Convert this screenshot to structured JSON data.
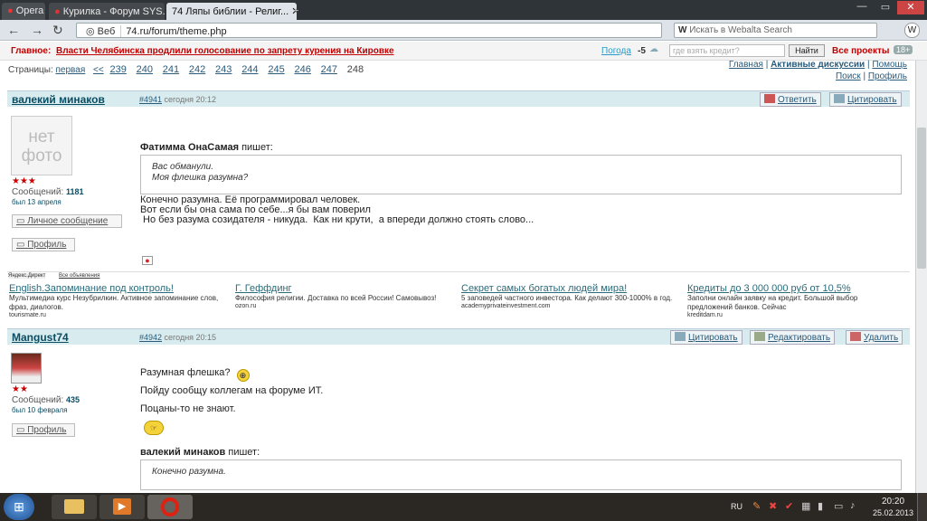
{
  "browser": {
    "opera_tab": "Opera",
    "tab1": "Курилка - Форум SYS...",
    "tab2": "74 Ляпы библии - Религ...",
    "new_tab": "+",
    "web": "Веб",
    "address": "74.ru/forum/theme.php",
    "search_placeholder": "Искать в Webalta Search",
    "back": "←",
    "fwd": "→",
    "reload": "↻"
  },
  "news": {
    "label": "Главное:",
    "headline": "Власти Челябинска продлили голосование по запрету курения на Кировке",
    "weather_label": "Погода",
    "weather_value": "-5",
    "search_placeholder": "где взять кредит?",
    "search_btn": "Найти",
    "projects": "Все проекты",
    "age": "18+"
  },
  "pager": {
    "label": "Страницы:",
    "first": "первая",
    "prev": "<<",
    "pages": [
      "239",
      "240",
      "241",
      "242",
      "243",
      "244",
      "245",
      "246",
      "247",
      "248"
    ]
  },
  "toplinks": {
    "main": "Главная",
    "active": "Активные дискуссии",
    "help": "Помощь",
    "search": "Поиск",
    "profile": "Профиль"
  },
  "post1": {
    "author": "валекий минаков",
    "num": "#4941",
    "date": "сегодня 20:12",
    "reply": "Ответить",
    "quote_btn": "Цитировать",
    "avatar_text": "нет фото",
    "stars": "★★★",
    "msgs_label": "Сообщений:",
    "msgs": "1181",
    "was": "был 13 апреля",
    "pm": "Личное сообщение",
    "profile": "Профиль",
    "quote_author": "Фатимма ОнаСамая",
    "writes": "пишет:",
    "quote_l1": "Вас обманули.",
    "quote_l2": "Моя флешка разумна?",
    "body_l1": "Конечно разумна. Её программировал человек.",
    "body_l2": "Вот если бы она сама по себе...я бы вам поверил",
    "body_l3": " Но без разума созидателя - никуда.  Как ни крути,  а впереди должно стоять слово..."
  },
  "ads": {
    "label1": "Яндекс.Директ",
    "label2": "Все объявления",
    "items": [
      {
        "title": "English.Запоминание под контроль!",
        "text": "Мультимедиа курс Незубрилкин. Активное запоминание слов, фраз, диалогов.",
        "url": "tourismate.ru"
      },
      {
        "title": "Г. Геффдинг",
        "text": "Философия религии. Доставка по всей России! Самовывоз!",
        "url": "ozon.ru"
      },
      {
        "title": "Секрет самых богатых людей мира!",
        "text": "5 заповедей частного инвестора. Как делают 300-1000% в год.",
        "url": "academyprivateinvestment.com"
      },
      {
        "title": "Кредиты до 3 000 000 руб от 10,5%",
        "text": "Заполни онлайн заявку на кредит. Большой выбор предложений банков. Сейчас",
        "url": "kreditdam.ru"
      }
    ]
  },
  "post2": {
    "author": "Mangust74",
    "num": "#4942",
    "date": "сегодня 20:15",
    "quote_btn": "Цитировать",
    "edit": "Редактировать",
    "delete": "Удалить",
    "stars": "★★",
    "msgs_label": "Сообщений:",
    "msgs": "435",
    "was": "был 10 февраля",
    "profile": "Профиль",
    "line1": "Разумная флешка?",
    "line2": "Пойду сообщу коллегам на форуме ИТ.",
    "line3": "Поцаны-то не знают.",
    "quote_author": "валекий минаков",
    "writes": "пишет:",
    "quote_l1": "Конечно разумна."
  },
  "taskbar": {
    "lang": "RU",
    "time": "20:20",
    "date": "25.02.2013"
  },
  "colors": {
    "accent": "#0b4d63",
    "head": "#d8ecef",
    "news_red": "#c00000"
  }
}
